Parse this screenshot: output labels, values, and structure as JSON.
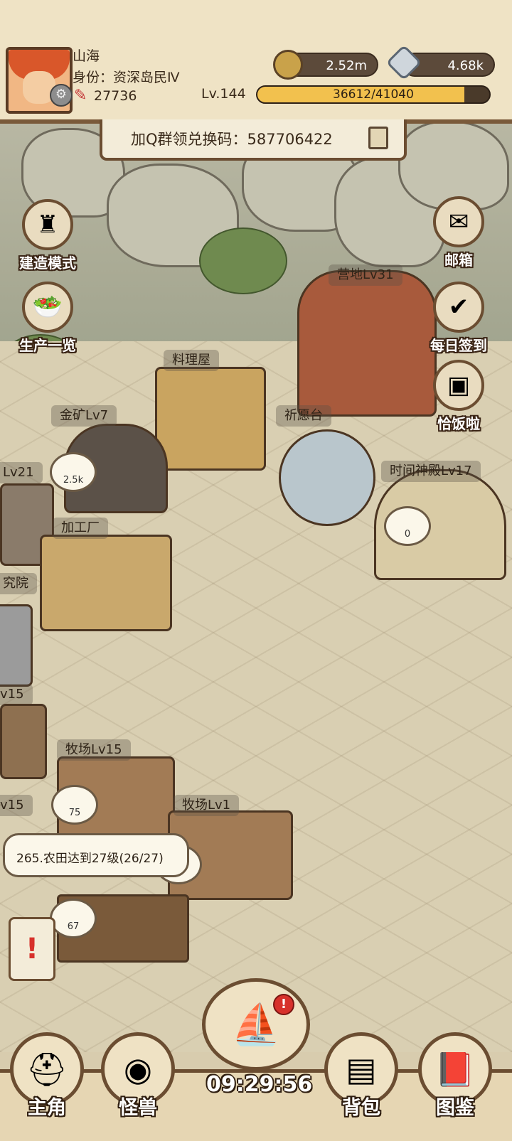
{
  "player": {
    "name": "山海",
    "identity": "身份：资深岛民Ⅳ",
    "power": "27736",
    "level": "Lv.144",
    "xp_text": "36612/41040",
    "xp_fraction": 0.892
  },
  "resources": {
    "coins": "2.52m",
    "gems": "4.68k"
  },
  "banner": {
    "redeem_text": "加Q群领兑换码：587706422"
  },
  "side_left": [
    {
      "label": "建造模式",
      "icon": "tower-icon"
    },
    {
      "label": "生产一览",
      "icon": "food-basket-icon"
    }
  ],
  "side_right": [
    {
      "label": "邮箱",
      "icon": "mailbox-icon"
    },
    {
      "label": "每日签到",
      "icon": "calendar-check-icon"
    },
    {
      "label": "恰饭啦",
      "icon": "treasure-chest-icon"
    }
  ],
  "buildings": {
    "camp": "营地Lv31",
    "kitchen": "料理屋",
    "gold_mine": "金矿Lv7",
    "shrine": "祈愿台",
    "temple": "时间神殿Lv17",
    "factory": "加工厂",
    "left_lv21": "Lv21",
    "research": "究院",
    "left_lv15_a": "v15",
    "ranch_15": "牧场Lv15",
    "left_lv15_b": "v15",
    "ranch_1": "牧场Lv1"
  },
  "bubbles": {
    "gold": "2.5k",
    "temple": "0",
    "eggs": "75",
    "ranch1": "6",
    "farm": "67"
  },
  "task": {
    "text": "265.农田达到27级(26/27)"
  },
  "bottom_nav": [
    {
      "label": "主角",
      "icon": "helmet-icon"
    },
    {
      "label": "怪兽",
      "icon": "monster-eye-icon"
    },
    {
      "label": "背包",
      "icon": "backpack-icon"
    },
    {
      "label": "图鉴",
      "icon": "book-icon"
    }
  ],
  "clock": "09:29:56"
}
